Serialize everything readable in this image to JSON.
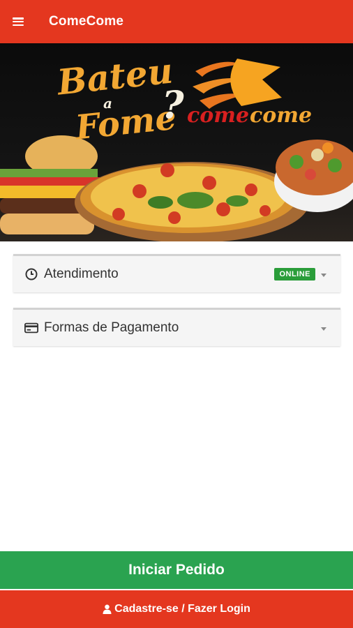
{
  "header": {
    "title": "ComeCome",
    "menu_icon": "menu-icon"
  },
  "banner": {
    "line1": "Bateu",
    "line2": "a",
    "line3": "Fome",
    "question": "?",
    "brand_red": "come",
    "brand_orange": "come"
  },
  "cards": [
    {
      "label": "Atendimento",
      "icon": "clock-icon",
      "badge": "ONLINE"
    },
    {
      "label": "Formas de Pagamento",
      "icon": "credit-card-icon"
    }
  ],
  "actions": {
    "start_order": "Iniciar Pedido",
    "signup_login": "Cadastre-se / Fazer Login",
    "signup_icon": "user-icon"
  },
  "colors": {
    "header_red": "#e4371f",
    "start_green": "#2aa350",
    "online_badge": "#2a9d3a"
  }
}
